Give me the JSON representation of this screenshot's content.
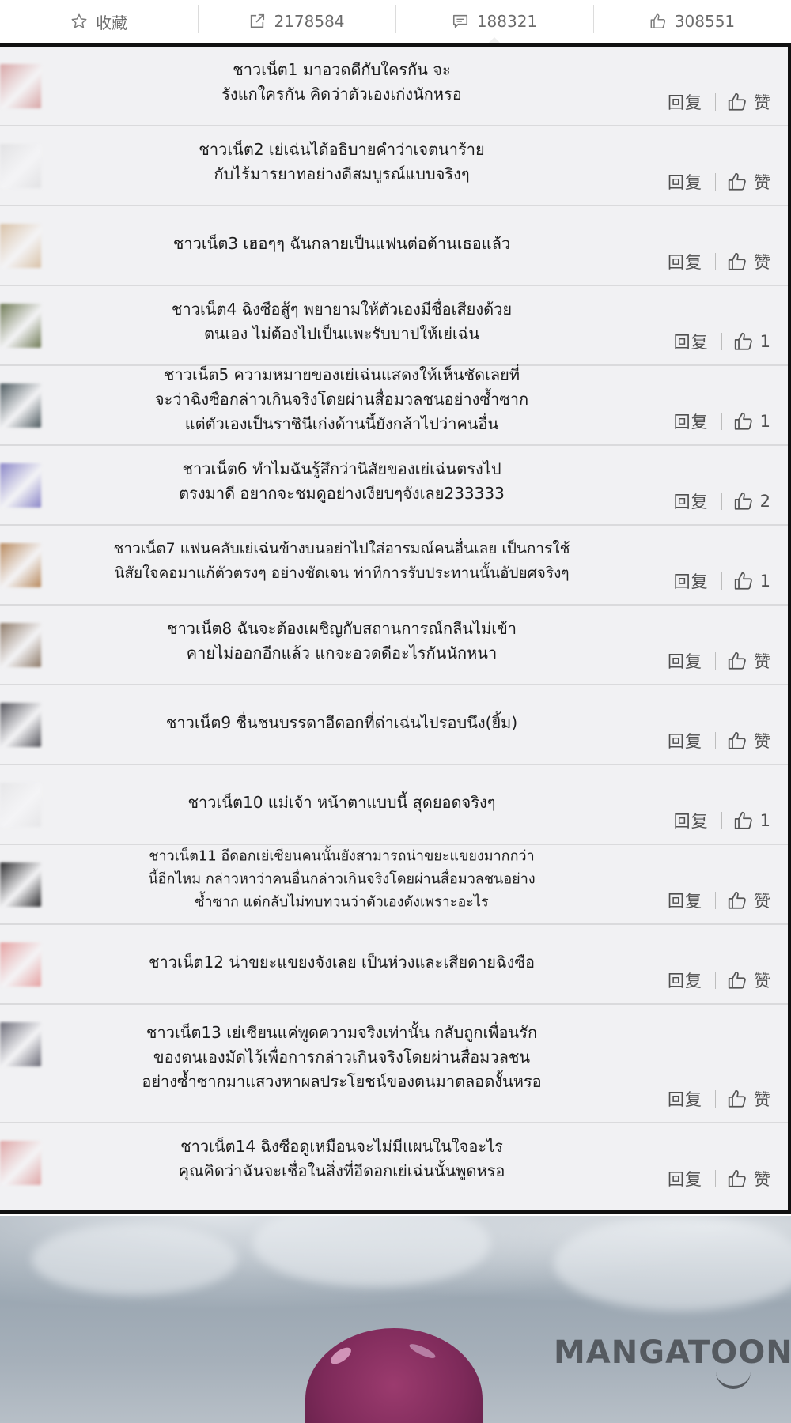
{
  "topbar": {
    "favorite_label": "收藏",
    "shares": "2178584",
    "comments": "188321",
    "likes": "308551",
    "active_tab": "comments"
  },
  "comment_actions": {
    "reply_label": "回复",
    "like_label": "赞"
  },
  "comments": [
    {
      "lines": [
        "ชาวเน็ต1 มาอวดดีกับใครกัน จะ",
        "รังแกใครกัน คิดว่าตัวเองเก่งนักหรอ"
      ],
      "likes": "赞",
      "avatar_color": "#d9a7a7"
    },
    {
      "lines": [
        "ชาวเน็ต2 เย่เฉ่นได้อธิบายคำว่าเจตนาร้าย",
        "กับไร้มารยาทอย่างดีสมบูรณ์แบบจริงๆ"
      ],
      "likes": "赞",
      "avatar_color": "#e2e2e4"
    },
    {
      "lines": [
        "ชาวเน็ต3 เฮอๆๆ ฉันกลายเป็นแฟนต่อต้านเธอแล้ว"
      ],
      "likes": "赞",
      "avatar_color": "#d9c2a8"
    },
    {
      "lines": [
        "ชาวเน็ต4 ฉิงซือสู้ๆ พยายามให้ตัวเองมีชื่อเสียงด้วย",
        "ตนเอง ไม่ต้องไปเป็นแพะรับบาปให้เย่เฉ่น"
      ],
      "likes": "1",
      "avatar_color": "#6f7a55"
    },
    {
      "lines": [
        "ชาวเน็ต5 ความหมายของเย่เฉ่นแสดงให้เห็นชัดเลยที่",
        "จะว่าฉิงซือกล่าวเกินจริงโดยผ่านสื่อมวลชนอย่างซ้ำซาก",
        "แต่ตัวเองเป็นราชินีเก่งด้านนี้ยังกล้าไปว่าคนอื่น"
      ],
      "likes": "1",
      "avatar_color": "#4d5a5f"
    },
    {
      "lines": [
        "ชาวเน็ต6 ทำไมฉันรู้สึกว่านิสัยของเย่เฉ่นตรงไป",
        "ตรงมาดี อยากจะชมดูอย่างเงียบๆจังเลย233333"
      ],
      "likes": "2",
      "avatar_color": "#8a86c8"
    },
    {
      "lines": [
        "ชาวเน็ต7 แฟนคลับเย่เฉ่นข้างบนอย่าไปใส่อารมณ์คนอื่นเลย เป็นการใช้",
        "นิสัยใจคอมาแก้ตัวตรงๆ อย่างชัดเจน ท่าทีการรับประทานนั้นอัปยศจริงๆ"
      ],
      "likes": "1",
      "avatar_color": "#b98a5e"
    },
    {
      "lines": [
        "ชาวเน็ต8 ฉันจะต้องเผชิญกับสถานการณ์กลืนไม่เข้า",
        "คายไม่ออกอีกแล้ว แกจะอวดดีอะไรกันนักหนา"
      ],
      "likes": "赞",
      "avatar_color": "#8e7a68"
    },
    {
      "lines": [
        "ชาวเน็ต9 ชื่นชนบรรดาอีดอกที่ด่าเฉ่นไปรอบนึง(ยิ้ม)"
      ],
      "likes": "赞",
      "avatar_color": "#55555c"
    },
    {
      "lines": [
        "ชาวเน็ต10 แม่เจ้า หน้าตาแบบนี้ สุดยอดจริงๆ"
      ],
      "likes": "1",
      "avatar_color": "#e6e6e8"
    },
    {
      "lines": [
        "ชาวเน็ต11 อีดอกเย่เซียนคนนั้นยังสามารถน่าขยะแขยงมากกว่า",
        "นี้อีกไหม กล่าวหาว่าคนอื่นกล่าวเกินจริงโดยผ่านสื่อมวลชนอย่าง",
        "ซ้ำซาก แต่กลับไม่ทบทวนว่าตัวเองดังเพราะอะไร"
      ],
      "likes": "赞",
      "avatar_color": "#2e2e30"
    },
    {
      "lines": [
        "ชาวเน็ต12 น่าขยะแขยงจังเลย เป็นห่วงและเสียดายฉิงซือ"
      ],
      "likes": "赞",
      "avatar_color": "#e6a2a2"
    },
    {
      "lines": [
        "ชาวเน็ต13 เย่เซียนแค่พูดความจริงเท่านั้น กลับถูกเพื่อนรัก",
        "ของตนเองมัดไว้เพื่อการกล่าวเกินจริงโดยผ่านสื่อมวลชน",
        "อย่างซ้ำซากมาแสวงหาผลประโยชน์ของตนมาตลอดงั้นหรอ"
      ],
      "likes": "赞",
      "avatar_color": "#6c6c78"
    },
    {
      "lines": [
        "ชาวเน็ต14 ฉิงซือดูเหมือนจะไม่มีแผนในใจอะไร",
        "คุณคิดว่าฉันจะเชื่อในสิ่งที่อีดอกเย่เฉ่นนั้นพูดหรอ"
      ],
      "likes": "赞",
      "avatar_color": "#e0a7a7"
    }
  ],
  "art": {
    "watermark": "MANGATOON",
    "hair_color": "#7e2a5a"
  }
}
